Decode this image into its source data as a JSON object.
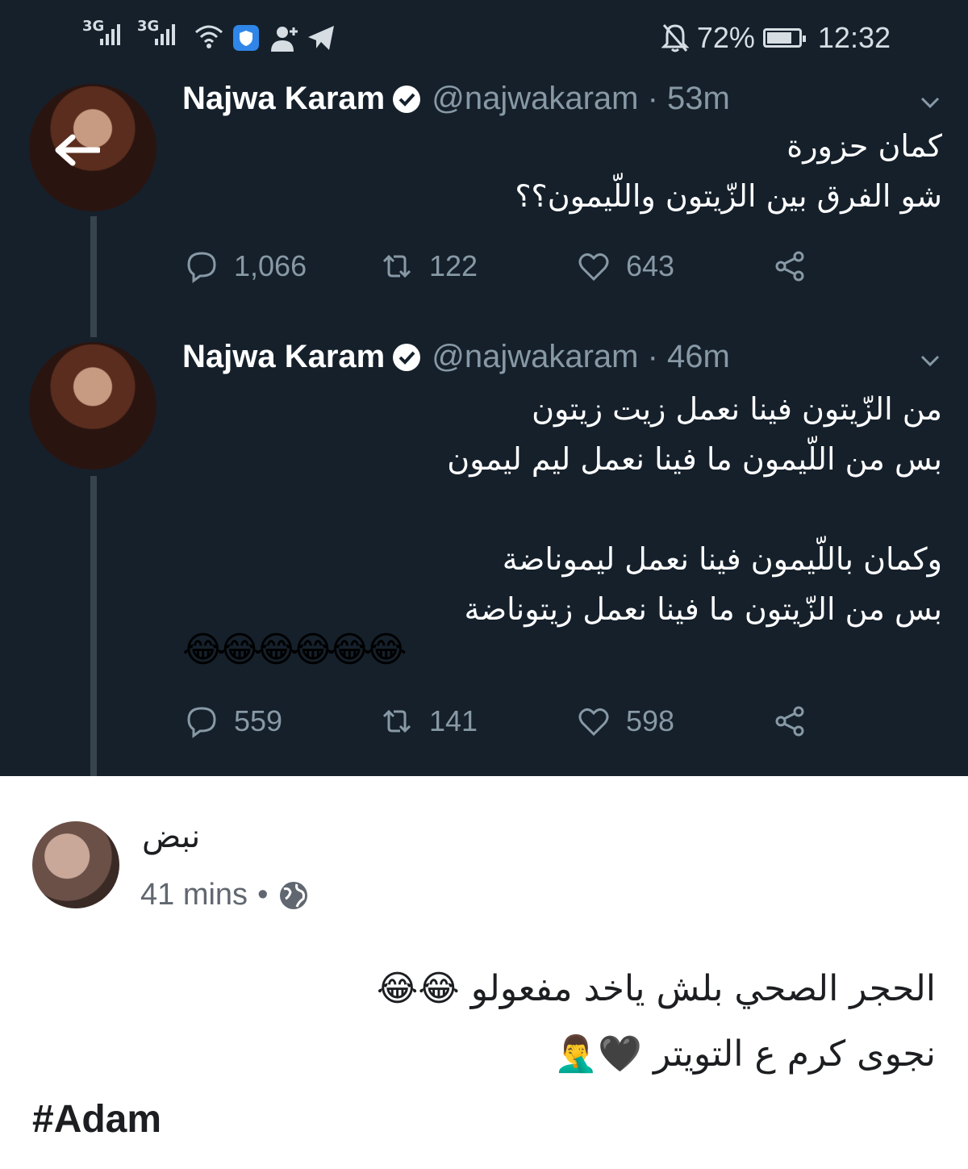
{
  "status_bar": {
    "network1": "3G",
    "network2": "3G",
    "battery_percent": "72%",
    "battery_level": 0.72,
    "time": "12:32"
  },
  "tweets": [
    {
      "name": "Najwa Karam",
      "handle": "@najwakaram · 53m",
      "lines": [
        "كمان حزورة",
        "شو الفرق بين الزّيتون واللّيمون؟؟"
      ],
      "replies": "1,066",
      "retweets": "122",
      "likes": "643"
    },
    {
      "name": "Najwa Karam",
      "handle": "@najwakaram · 46m",
      "lines": [
        "من الزّيتون فينا نعمل زيت زيتون",
        "بس من اللّيمون ما فينا نعمل ليم ليمون",
        "وكمان باللّيمون فينا نعمل ليموناضة",
        "بس من الزّيتون ما فينا نعمل زيتوناضة"
      ],
      "emojis": "😂😂😂😂😂😂",
      "replies": "559",
      "retweets": "141",
      "likes": "598"
    }
  ],
  "post": {
    "author": "نبض",
    "time": "41 mins",
    "separator": "•",
    "line1": "الحجر الصحي بلش ياخد مفعولو 😂😂",
    "line2": "نجوى كرم ع التويتر 🖤🤦‍♂️",
    "hashtag": "#Adam"
  },
  "colors": {
    "dark_bg": "#15202b",
    "muted": "#8899a6",
    "thread_line": "#38444d"
  }
}
